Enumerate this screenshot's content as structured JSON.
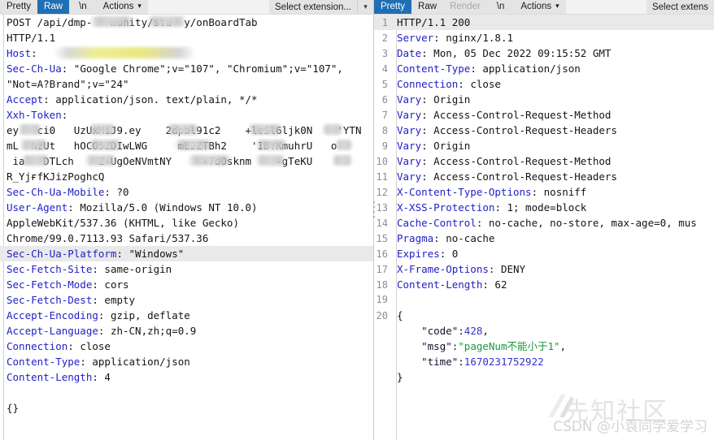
{
  "request_panel": {
    "toolbar": {
      "tabs": [
        {
          "label": "Pretty",
          "state": "normal"
        },
        {
          "label": "Raw",
          "state": "active"
        },
        {
          "label": "\\n",
          "state": "normal"
        },
        {
          "label": "Actions",
          "state": "menu"
        }
      ],
      "select_extension": "Select extension...",
      "chevron": "▾"
    },
    "lines": [
      {
        "n": "",
        "type": "plain",
        "text": "POST /api/dmp-███munity/sta██y/onBoardTab",
        "redacted": true
      },
      {
        "n": "",
        "type": "plain",
        "text": "HTTP/1.1"
      },
      {
        "n": "",
        "type": "header",
        "key": "Host",
        "value": "",
        "redacted": "highlight"
      },
      {
        "n": "",
        "type": "header",
        "key": "Sec-Ch-Ua",
        "value": "\"Google Chrome\";v=\"107\", \"Chromium\";v=\"107\","
      },
      {
        "n": "",
        "type": "plain",
        "text": "\"Not=A?Brand\";v=\"24\""
      },
      {
        "n": "",
        "type": "header",
        "key": "Accept",
        "value": "application/json. text/plain, */*"
      },
      {
        "n": "",
        "type": "header",
        "key": "Xxh-Token",
        "value": ""
      },
      {
        "n": "",
        "type": "plain",
        "text": "ey█ █ci0   UzUxMiJ9.ey█  █2dpbl91c2█  █+leSl6ljk0N█  █'YTN",
        "redacted": true
      },
      {
        "n": "",
        "type": "plain",
        "text": "mL█ NzUt█  hOCO5ZDIwLWG█   █mE2ZTBh2█  █'IBYKmuhrU█ █o",
        "redacted": true
      },
      {
        "n": "",
        "type": "plain",
        "text": " ia█  DTLch█  █Z-UgOeNVmtNY█   █+7dOsknm█  █-gTeKU██",
        "redacted": true
      },
      {
        "n": "",
        "type": "plain",
        "text": "R_YјғfKJizPoghcQ"
      },
      {
        "n": "",
        "type": "header",
        "key": "Sec-Ch-Ua-Mobile",
        "value": "?0"
      },
      {
        "n": "",
        "type": "header",
        "key": "User-Agent",
        "value": "Mozilla/5.0 (Windows NT 10.0)"
      },
      {
        "n": "",
        "type": "plain",
        "text": "AppleWebKit/537.36 (KHTML, like Gecko)"
      },
      {
        "n": "",
        "type": "plain",
        "text": "Chrome/99.0.7113.93 Safari/537.36"
      },
      {
        "n": "",
        "type": "header",
        "key": "Sec-Ch-Ua-Platform",
        "value": "\"Windows\"",
        "highlight": true
      },
      {
        "n": "",
        "type": "header",
        "key": "Sec-Fetch-Site",
        "value": "same-origin"
      },
      {
        "n": "",
        "type": "header",
        "key": "Sec-Fetch-Mode",
        "value": "cors"
      },
      {
        "n": "",
        "type": "header",
        "key": "Sec-Fetch-Dest",
        "value": "empty"
      },
      {
        "n": "",
        "type": "header",
        "key": "Accept-Encoding",
        "value": "gzip, deflate"
      },
      {
        "n": "",
        "type": "header",
        "key": "Accept-Language",
        "value": "zh-CN,zh;q=0.9"
      },
      {
        "n": "",
        "type": "header",
        "key": "Connection",
        "value": "close"
      },
      {
        "n": "",
        "type": "header",
        "key": "Content-Type",
        "value": "application/json"
      },
      {
        "n": "",
        "type": "header",
        "key": "Content-Length",
        "value": "4"
      },
      {
        "n": "",
        "type": "plain",
        "text": ""
      },
      {
        "n": "",
        "type": "plain",
        "text": "{}"
      }
    ]
  },
  "response_panel": {
    "toolbar": {
      "tabs": [
        {
          "label": "Pretty",
          "state": "active"
        },
        {
          "label": "Raw",
          "state": "normal"
        },
        {
          "label": "Render",
          "state": "disabled"
        },
        {
          "label": "\\n",
          "state": "normal"
        },
        {
          "label": "Actions",
          "state": "menu"
        }
      ],
      "select_extension": "Select extens",
      "chevron": "▾"
    },
    "lines": [
      {
        "n": "1",
        "type": "plain",
        "text": "HTTP/1.1 200",
        "highlight": true
      },
      {
        "n": "2",
        "type": "header",
        "key": "Server",
        "value": "nginx/1.8.1"
      },
      {
        "n": "3",
        "type": "header",
        "key": "Date",
        "value": "Mon, 05 Dec 2022 09:15:52 GMT"
      },
      {
        "n": "4",
        "type": "header",
        "key": "Content-Type",
        "value": "application/json"
      },
      {
        "n": "5",
        "type": "header",
        "key": "Connection",
        "value": "close"
      },
      {
        "n": "6",
        "type": "header",
        "key": "Vary",
        "value": "Origin"
      },
      {
        "n": "7",
        "type": "header",
        "key": "Vary",
        "value": "Access-Control-Request-Method"
      },
      {
        "n": "8",
        "type": "header",
        "key": "Vary",
        "value": "Access-Control-Request-Headers"
      },
      {
        "n": "9",
        "type": "header",
        "key": "Vary",
        "value": "Origin"
      },
      {
        "n": "10",
        "type": "header",
        "key": "Vary",
        "value": "Access-Control-Request-Method"
      },
      {
        "n": "11",
        "type": "header",
        "key": "Vary",
        "value": "Access-Control-Request-Headers"
      },
      {
        "n": "12",
        "type": "header",
        "key": "X-Content-Type-Options",
        "value": "nosniff"
      },
      {
        "n": "13",
        "type": "header",
        "key": "X-XSS-Protection",
        "value": "1; mode=block"
      },
      {
        "n": "14",
        "type": "header",
        "key": "Cache-Control",
        "value": "no-cache, no-store, max-age=0, mus"
      },
      {
        "n": "15",
        "type": "header",
        "key": "Pragma",
        "value": "no-cache"
      },
      {
        "n": "16",
        "type": "header",
        "key": "Expires",
        "value": "0"
      },
      {
        "n": "17",
        "type": "header",
        "key": "X-Frame-Options",
        "value": "DENY"
      },
      {
        "n": "18",
        "type": "header",
        "key": "Content-Length",
        "value": "62"
      },
      {
        "n": "19",
        "type": "plain",
        "text": ""
      },
      {
        "n": "20",
        "type": "plain",
        "text": "{"
      },
      {
        "n": "",
        "type": "json",
        "key": "\"code\"",
        "sep": ":",
        "value": "428",
        "vkind": "num",
        "tail": ","
      },
      {
        "n": "",
        "type": "json",
        "key": "\"msg\"",
        "sep": ":",
        "value": "\"pageNum不能小于1\"",
        "vkind": "str",
        "tail": ","
      },
      {
        "n": "",
        "type": "json",
        "key": "\"time\"",
        "sep": ":",
        "value": "1670231752922",
        "vkind": "num",
        "tail": ""
      },
      {
        "n": "",
        "type": "plain",
        "text": "}"
      }
    ]
  },
  "watermark": {
    "logo_text": "先知社区",
    "credit": "CSDN @小袁同学爱学习"
  },
  "colors": {
    "accent": "#1f6fb4",
    "header_key": "#2020c8",
    "json_string": "#1a9a3c",
    "json_number": "#3333cc",
    "highlight_row": "#e9e9e9",
    "highlight_yellow": "#eeec8c"
  }
}
